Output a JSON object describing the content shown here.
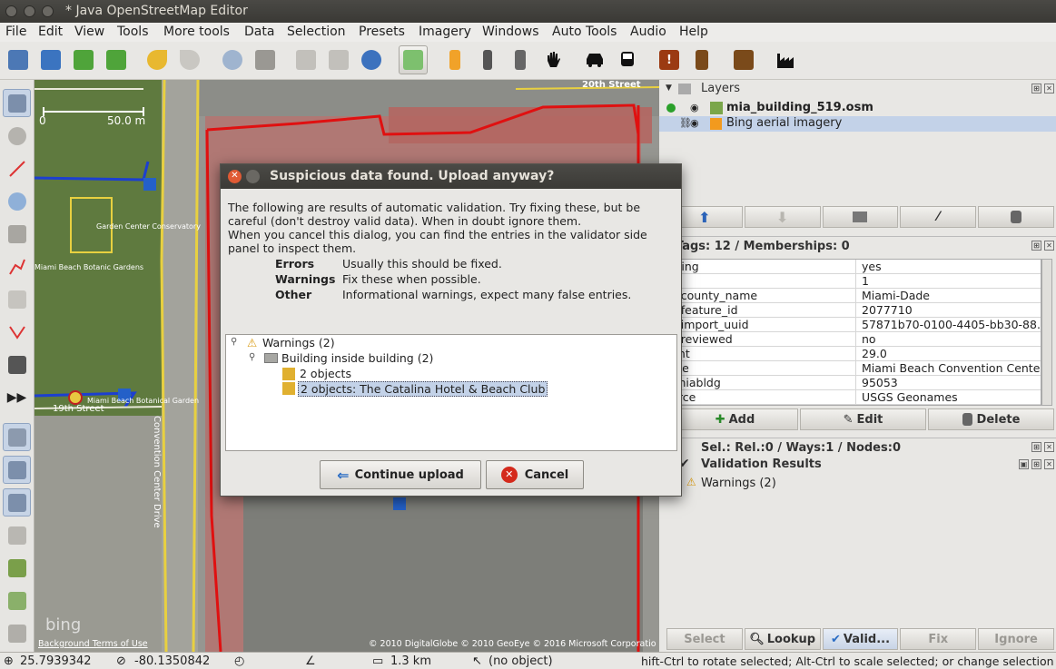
{
  "window": {
    "title": "* Java OpenStreetMap Editor"
  },
  "menu": [
    "File",
    "Edit",
    "View",
    "Tools",
    "More tools",
    "Data",
    "Selection",
    "Presets",
    "Imagery",
    "Windows",
    "Auto Tools",
    "Audio",
    "Help"
  ],
  "map": {
    "scale_zero": "0",
    "scale_label": "50.0 m",
    "street_20th": "20th Street",
    "street_19th": "19th Street",
    "label_conservatory": "Garden Center Conservatory",
    "label_gardens": "Miami Beach Botanic Gardens",
    "label_botanical": "Miami Beach Botanical Garden",
    "label_convention_drive": "Convention Center Drive",
    "bing_logo": "bing",
    "background_terms": "Background Terms of Use",
    "copyright": "© 2010 DigitalGlobe © 2010 GeoEye © 2016 Microsoft Corporatio"
  },
  "layers": {
    "title": "Layers",
    "items": [
      {
        "name": "mia_building_519.osm"
      },
      {
        "name": "Bing aerial imagery"
      }
    ]
  },
  "tags": {
    "title": "Tags: 12 / Memberships: 0",
    "rows": [
      {
        "key": "lding",
        "value": "yes"
      },
      {
        "key": "",
        "value": "1"
      },
      {
        "key": "s:county_name",
        "value": "Miami-Dade"
      },
      {
        "key": "s:feature_id",
        "value": "2077710"
      },
      {
        "key": "s:import_uuid",
        "value": "57871b70-0100-4405-bb30-88..."
      },
      {
        "key": "s:reviewed",
        "value": "no"
      },
      {
        "key": "ght",
        "value": "29.0"
      },
      {
        "key": "me",
        "value": "Miami Beach Convention Center"
      },
      {
        "key": ":miabldg",
        "value": "95053"
      },
      {
        "key": "urce",
        "value": "USGS Geonames"
      }
    ],
    "buttons": {
      "add": "Add",
      "edit": "Edit",
      "delete": "Delete"
    }
  },
  "selection": {
    "title": "Sel.: Rel.:0 / Ways:1 / Nodes:0"
  },
  "validation": {
    "title": "Validation Results",
    "item": "Warnings (2)",
    "buttons": {
      "select": "Select",
      "lookup": "Lookup",
      "valid": "Valid...",
      "fix": "Fix",
      "ignore": "Ignore"
    }
  },
  "dialog": {
    "title": "Suspicious data found. Upload anyway?",
    "intro": [
      "The following are results of automatic validation. Try fixing these, but be",
      "careful (don't destroy valid data). When in doubt ignore them.",
      "When you cancel this dialog, you can find the entries in the validator side",
      "panel to inspect them."
    ],
    "legend": [
      {
        "label": "Errors",
        "desc": "Usually this should be fixed."
      },
      {
        "label": "Warnings",
        "desc": "Fix these when possible."
      },
      {
        "label": "Other",
        "desc": "Informational warnings, expect many false entries."
      }
    ],
    "tree": {
      "root": "Warnings (2)",
      "group": "Building inside building (2)",
      "items": [
        "2 objects",
        "2 objects: The Catalina Hotel & Beach Club"
      ]
    },
    "continue": "Continue upload",
    "cancel": "Cancel"
  },
  "status": {
    "lat": "25.7939342",
    "lon": "-80.1350842",
    "distance": "1.3 km",
    "object": "(no object)",
    "help": "hift-Ctrl to rotate selected; Alt-Ctrl to scale selected; or change selection"
  }
}
